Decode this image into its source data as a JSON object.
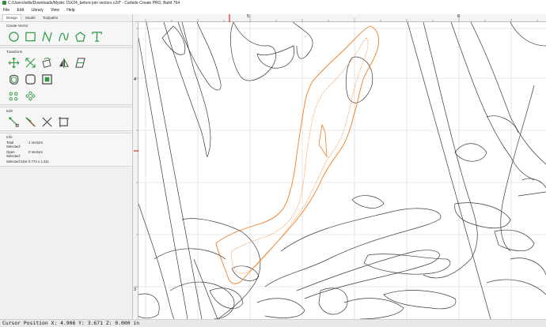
{
  "window": {
    "title": "C:/Users/wills/Downloads/Mystic 15X24_before join vectors.c2d* - Carbide Create PRO, Build 764"
  },
  "menu": [
    "File",
    "Edit",
    "Library",
    "View",
    "Help"
  ],
  "tabs": [
    {
      "label": "Design",
      "active": true
    },
    {
      "label": "Model",
      "active": false
    },
    {
      "label": "Toolpaths",
      "active": false
    }
  ],
  "groups": {
    "create_vector": {
      "title": "Create Vector"
    },
    "transform": {
      "title": "Transform"
    },
    "edit": {
      "title": "Edit"
    },
    "info": {
      "title": "Info"
    }
  },
  "info": {
    "total_selected_label": "Total Selected:",
    "total_selected_value": "1 Vectors",
    "open_selected_label": "Open Selected:",
    "open_selected_value": "0 Vectors",
    "selected_size_label": "Selected Size:",
    "selected_size_value": "0.774 x 1.311"
  },
  "rulers": {
    "h_labels": [
      "5",
      "6"
    ],
    "v_labels": [
      "4",
      "3"
    ]
  },
  "status": {
    "cursor_text": "Cursor Position X: 4.906 Y: 3.671 Z: 0.000 in"
  },
  "colors": {
    "selected_vector": "#f07f24",
    "vector": "#333333",
    "grid": "#c8c8c8",
    "ruler_marker": "#e00000",
    "icon_green": "#2e9a45"
  },
  "icons": {
    "create_vector": [
      "circle-icon",
      "rectangle-icon",
      "polyline-icon",
      "curve-icon",
      "polygon-icon",
      "text-icon"
    ],
    "transform": [
      "move-icon",
      "scale-icon",
      "rotate-icon",
      "mirror-icon",
      "skew-icon",
      "offset-icon",
      "fillet-icon",
      "boolean-icon",
      "align-center-icon",
      "group-dots-icon"
    ],
    "edit": [
      "node-edit-icon",
      "knife-icon",
      "trim-icon",
      "bounding-box-icon"
    ]
  }
}
